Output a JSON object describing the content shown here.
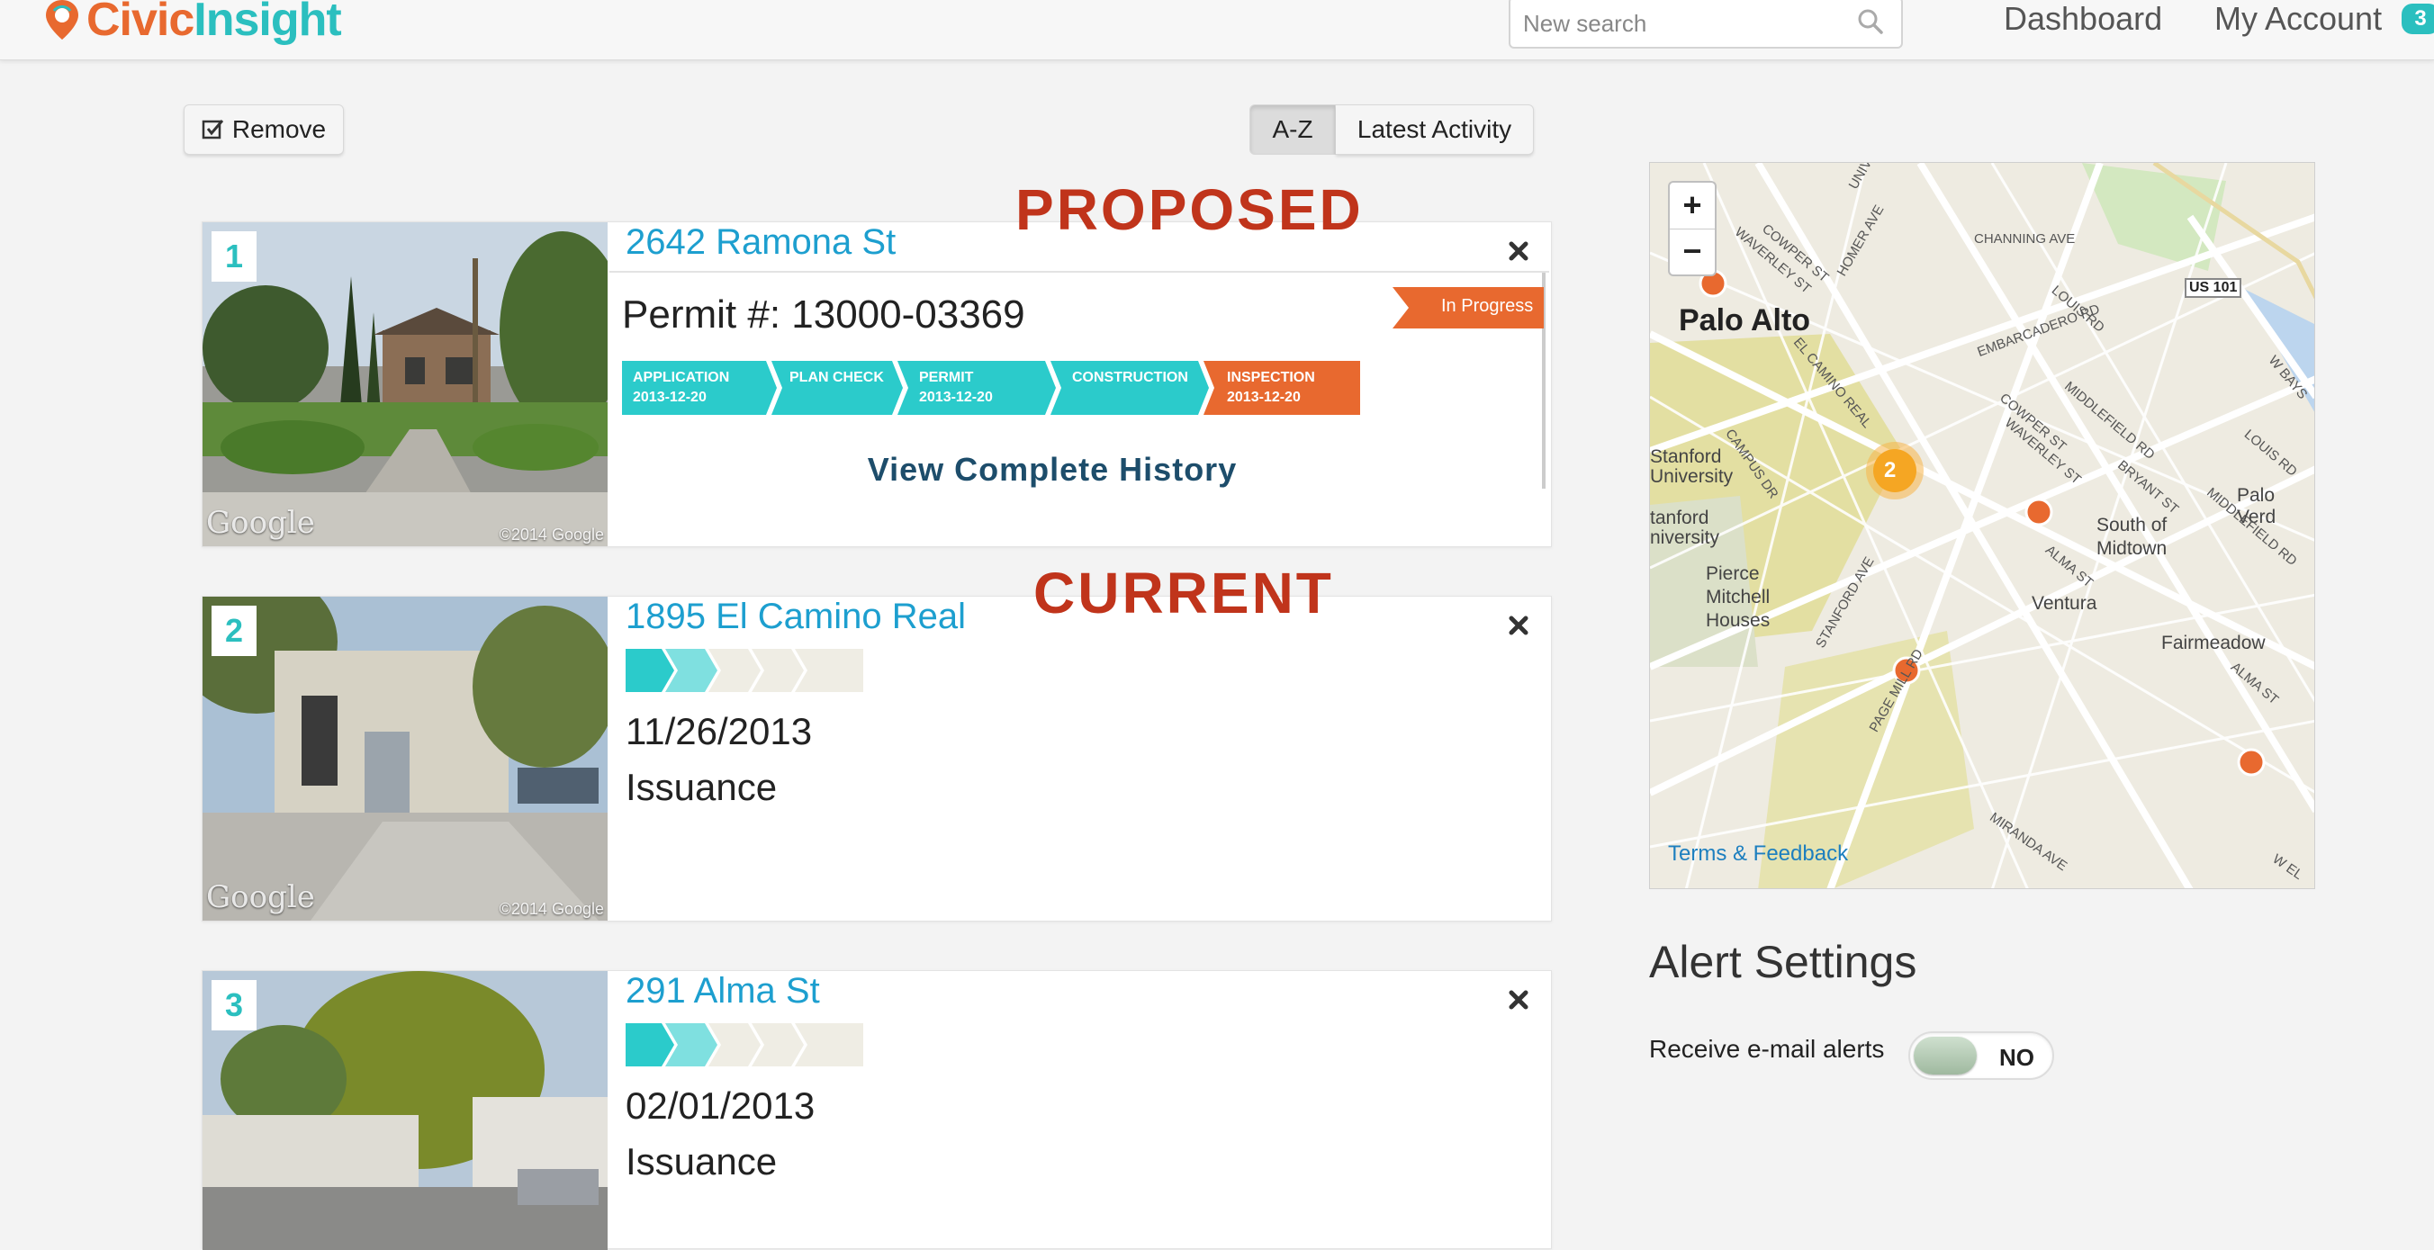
{
  "header": {
    "logo_part1": "Civic",
    "logo_part2": "Insight",
    "search_placeholder": "New search",
    "nav": {
      "dashboard": "Dashboard",
      "my_account": "My Account",
      "badge": "3"
    }
  },
  "toolbar": {
    "remove_label": "Remove",
    "sort": {
      "az": "A-Z",
      "latest": "Latest Activity",
      "active": "A-Z"
    }
  },
  "overlay_labels": {
    "proposed": "PROPOSED",
    "current": "CURRENT"
  },
  "cards": [
    {
      "number": "1",
      "title": "2642 Ramona St",
      "photo_watermark": "Google",
      "photo_copyright": "©2014 Google",
      "permit_number": "Permit #: 13000-03369",
      "status": "In Progress",
      "steps": [
        {
          "name": "APPLICATION",
          "date": "2013-12-20"
        },
        {
          "name": "PLAN CHECK",
          "date": ""
        },
        {
          "name": "PERMIT",
          "date": "2013-12-20"
        },
        {
          "name": "CONSTRUCTION",
          "date": ""
        },
        {
          "name": "INSPECTION",
          "date": "2013-12-20"
        }
      ],
      "view_history": "View Complete History"
    },
    {
      "number": "2",
      "title": "1895 El Camino Real",
      "photo_watermark": "Google",
      "photo_copyright": "©2014 Google",
      "date": "11/26/2013",
      "stage": "Issuance",
      "progress_steps_complete": 2,
      "progress_steps_total": 5
    },
    {
      "number": "3",
      "title": "291 Alma St",
      "date": "02/01/2013",
      "stage": "Issuance",
      "progress_steps_complete": 2,
      "progress_steps_total": 5
    }
  ],
  "map": {
    "zoom_in": "+",
    "zoom_out": "−",
    "terms": "Terms & Feedback",
    "cluster_count": "2",
    "labels": {
      "palo_alto": "Palo Alto",
      "stanford1": "Stanford\nUniversity",
      "stanford2": "tanford\nniversity",
      "pierce": "Pierce\nMitchell\nHouses",
      "south_midtown": "South of\nMidtown",
      "ventura": "Ventura",
      "fairmeadow": "Fairmeadow",
      "palo_verde": "Palo Verd",
      "us101": "US 101",
      "channing": "CHANNING AVE",
      "embarcadero": "EMBARCADERO RD",
      "el_camino": "EL CAMINO REAL",
      "alma": "ALMA ST",
      "middlefield": "MIDDLEFIELD RD",
      "louis": "LOUIS RD",
      "cowper": "COWPER ST",
      "waverley": "WAVERLEY ST",
      "bryant": "BRYANT ST",
      "page_mill": "PAGE MILL RD",
      "stanford_ave": "STANFORD AVE",
      "campus": "CAMPUS DR",
      "miranda": "MIRANDA AVE",
      "w_bays": "W BAYS",
      "w_el": "W EL",
      "univ": "UNIV",
      "homer": "HOMER AVE"
    }
  },
  "alerts": {
    "title": "Alert Settings",
    "email_label": "Receive e-mail alerts",
    "toggle_state": "NO"
  },
  "colors": {
    "teal": "#2bbfbf",
    "orange": "#e8692f",
    "link_blue": "#1d9fcf",
    "label_red": "#c0341b"
  }
}
